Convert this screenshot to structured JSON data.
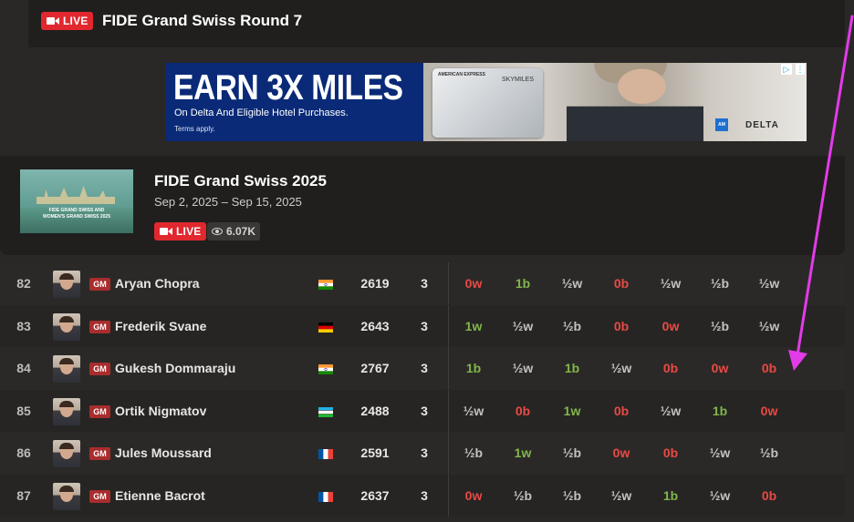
{
  "topbar": {
    "live_label": "LIVE",
    "title": "FIDE Grand Swiss Round 7"
  },
  "ad": {
    "headline": "EARN 3X MILES",
    "subline": "On Delta And Eligible Hotel Purchases.",
    "terms": "Terms apply.",
    "card_issuer": "AMERICAN EXPRESS",
    "card_program": "SKYMILES",
    "brand": "DELTA",
    "adchoices_icon": "adchoices-icon",
    "menu_icon": "ad-menu-icon"
  },
  "event": {
    "thumbnail_line1": "FIDE GRAND SWISS AND",
    "thumbnail_line2": "WOMEN'S GRAND SWISS 2025",
    "name": "FIDE Grand Swiss 2025",
    "dates": "Sep 2, 2025 – Sep 15, 2025",
    "live_label": "LIVE",
    "viewers": "6.07K"
  },
  "colors": {
    "live": "#e0282e",
    "win": "#81b64c",
    "loss": "#e84a45",
    "draw": "#c4c2bf",
    "annotation_arrow": "#e23be8"
  },
  "players": [
    {
      "rank": "82",
      "title": "GM",
      "name": "Aryan Chopra",
      "flag": "india",
      "rating": "2619",
      "score": "3",
      "results": [
        "0w",
        "1b",
        "½w",
        "0b",
        "½w",
        "½b",
        "½w"
      ]
    },
    {
      "rank": "83",
      "title": "GM",
      "name": "Frederik Svane",
      "flag": "germany",
      "rating": "2643",
      "score": "3",
      "results": [
        "1w",
        "½w",
        "½b",
        "0b",
        "0w",
        "½b",
        "½w"
      ]
    },
    {
      "rank": "84",
      "title": "GM",
      "name": "Gukesh Dommaraju",
      "flag": "india",
      "rating": "2767",
      "score": "3",
      "results": [
        "1b",
        "½w",
        "1b",
        "½w",
        "0b",
        "0w",
        "0b"
      ]
    },
    {
      "rank": "85",
      "title": "GM",
      "name": "Ortik Nigmatov",
      "flag": "uzbekistan",
      "rating": "2488",
      "score": "3",
      "results": [
        "½w",
        "0b",
        "1w",
        "0b",
        "½w",
        "1b",
        "0w"
      ]
    },
    {
      "rank": "86",
      "title": "GM",
      "name": "Jules Moussard",
      "flag": "france",
      "rating": "2591",
      "score": "3",
      "results": [
        "½b",
        "1w",
        "½b",
        "0w",
        "0b",
        "½w",
        "½b"
      ]
    },
    {
      "rank": "87",
      "title": "GM",
      "name": "Etienne Bacrot",
      "flag": "france",
      "rating": "2637",
      "score": "3",
      "results": [
        "0w",
        "½b",
        "½b",
        "½w",
        "1b",
        "½w",
        "0b"
      ]
    }
  ]
}
